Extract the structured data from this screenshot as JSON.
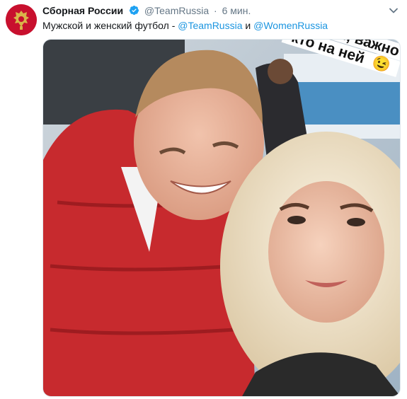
{
  "tweet": {
    "author_name": "Сборная России",
    "handle": "@TeamRussia",
    "separator": "·",
    "time": "6 мин.",
    "text_prefix": "Мужской и женский футбол - ",
    "mention_1": "@TeamRussia",
    "conjunction": " и ",
    "mention_2": "@WomenRussia",
    "verified_icon": "verified-badge-icon",
    "menu_icon": "chevron-down-icon"
  },
  "photo": {
    "overlay_line_1": "фия, важно",
    "overlay_line_2": "кто на ней",
    "overlay_emoji": "😉"
  },
  "colors": {
    "link": "#1b95e0",
    "secondary": "#657786",
    "avatar_bg": "#c8102e"
  }
}
